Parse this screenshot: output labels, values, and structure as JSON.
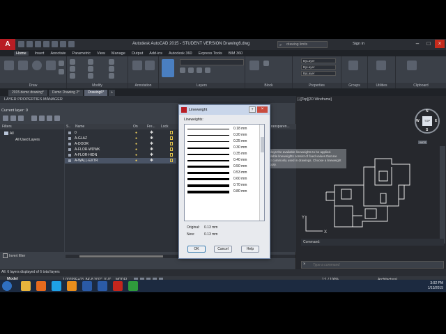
{
  "app": {
    "logo": "A",
    "window_title": "Autodesk AutoCAD 2015 - STUDENT VERSION    Drawing6.dwg",
    "search_placeholder": "drawing limits",
    "signin": "Sign In",
    "window_buttons": [
      "–",
      "□",
      "×"
    ]
  },
  "ribbon": {
    "tabs": [
      "Home",
      "Insert",
      "Annotate",
      "Parametric",
      "View",
      "Manage",
      "Output",
      "Add-ins",
      "Autodesk 360",
      "Express Tools",
      "BIM 360"
    ],
    "active_tab": "Home",
    "panels": [
      "Draw",
      "Modify",
      "Annotation",
      "Layers",
      "Block",
      "Properties",
      "Groups",
      "Utilities",
      "Clipboard"
    ],
    "properties_values": [
      "ByLayer",
      "ByLayer",
      "ByLayer"
    ]
  },
  "file_tabs": [
    "2015 demo drawing*",
    "Demo Drawing 2*",
    "Drawing6*",
    "+"
  ],
  "active_file_tab": "Drawing6*",
  "layer_manager": {
    "title": "LAYER PROPERTIES MANAGER",
    "current_layer": "Current layer: 0",
    "filters_header": "Filters",
    "filter_nodes": [
      "All",
      "All Used Layers"
    ],
    "columns": [
      "S..",
      "Name",
      "On",
      "Fre...",
      "Lock"
    ],
    "layers": [
      {
        "name": "0",
        "selected": false
      },
      {
        "name": "A-GLAZ",
        "selected": false
      },
      {
        "name": "A-DOOR",
        "selected": false
      },
      {
        "name": "A-FLOR-WDWK",
        "selected": false
      },
      {
        "name": "A-FLOR-HIDN",
        "selected": false
      },
      {
        "name": "A-WALL-EXTR",
        "selected": true
      }
    ],
    "search_hint": "layer",
    "extra_column": "ransparen...",
    "invert_filter": "Invert filter",
    "status": "All: 6 layers displayed of 6 total layers"
  },
  "viewport": {
    "label": "[-][Top][2D Wireframe]",
    "viewcube": {
      "top": "TOP",
      "north": "N",
      "south": "S",
      "east": "E",
      "west": "W"
    },
    "wcs": "WCS",
    "tooltip": "Displays the available lineweights to be applied. Available lineweights consist of fixed values that are most commonly used in drawings. Choose a lineweight to apply.",
    "ucs_x": "X",
    "ucs_y": "Y"
  },
  "command": {
    "history": "Command:",
    "placeholder": "Type a command",
    "close": "×"
  },
  "statusbar": {
    "model_tab": "Model",
    "coords": "1.00769E+03, 84'-8 3/32\", 0'-0\"",
    "mode": "MODEL",
    "scale": "1:1 / 100%",
    "units": "Architectural"
  },
  "taskbar": {
    "time": "3:02 PM",
    "date": "1/13/2015",
    "icons": [
      {
        "name": "file-explorer-icon",
        "color": "#e7b43c"
      },
      {
        "name": "firefox-icon",
        "color": "#e66a1e"
      },
      {
        "name": "skype-icon",
        "color": "#1ea1e6"
      },
      {
        "name": "media-icon",
        "color": "#e88d1c"
      },
      {
        "name": "revit-icon",
        "color": "#2a5aa6"
      },
      {
        "name": "word-icon",
        "color": "#2b5ba8"
      },
      {
        "name": "acrobat-icon",
        "color": "#c4261d"
      },
      {
        "name": "camtasia-icon",
        "color": "#2f9a3c"
      }
    ]
  },
  "lineweight_dialog": {
    "title": "Lineweight",
    "section_label": "Lineweights:",
    "items": [
      {
        "label": "0.18 mm",
        "weight": 0.18
      },
      {
        "label": "0.20 mm",
        "weight": 0.2
      },
      {
        "label": "0.25 mm",
        "weight": 0.25
      },
      {
        "label": "0.30 mm",
        "weight": 0.3
      },
      {
        "label": "0.35 mm",
        "weight": 0.35
      },
      {
        "label": "0.40 mm",
        "weight": 0.4
      },
      {
        "label": "0.50 mm",
        "weight": 0.5
      },
      {
        "label": "0.53 mm",
        "weight": 0.53
      },
      {
        "label": "0.60 mm",
        "weight": 0.6
      },
      {
        "label": "0.70 mm",
        "weight": 0.7
      },
      {
        "label": "0.80 mm",
        "weight": 0.8
      }
    ],
    "original_label": "Original:",
    "original_value": "0.13 mm",
    "new_label": "New:",
    "new_value": "0.13 mm",
    "ok": "OK",
    "cancel": "Cancel",
    "help": "Help",
    "help_glyph": "?",
    "close_glyph": "×"
  },
  "colors": {
    "autocad_red": "#b81d24",
    "dark_ui": "#2b2f36",
    "selection": "#4a5466"
  }
}
